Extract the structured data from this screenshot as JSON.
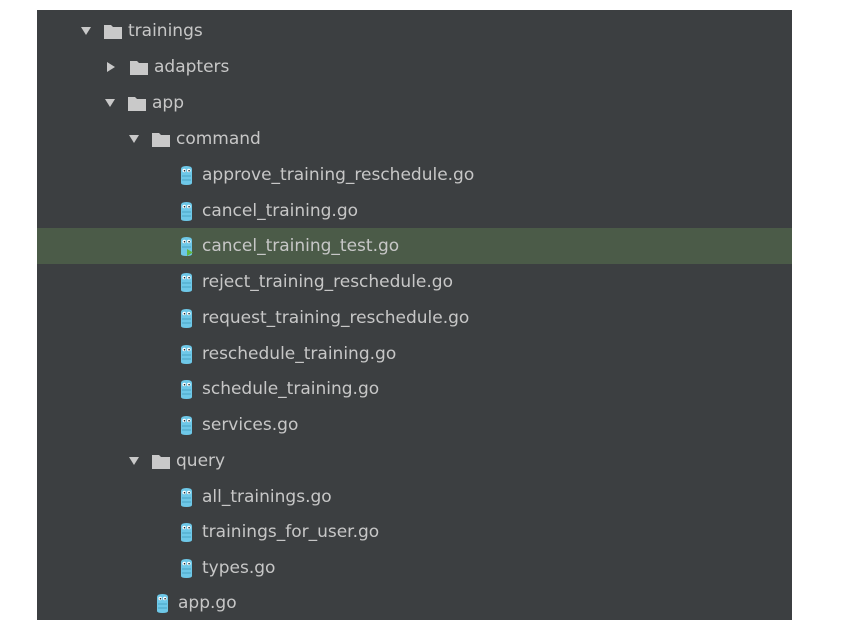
{
  "colors": {
    "panel_background": "#3c3f41",
    "selected_row": "#4b5b48",
    "text": "#c7c7c7",
    "folder": "#c9c9c9",
    "go_file_icon": "#6ec8e8"
  },
  "tree": {
    "trainings": {
      "label": "trainings",
      "state": "expanded",
      "icon": "folder-icon"
    },
    "adapters": {
      "label": "adapters",
      "state": "collapsed",
      "icon": "folder-icon"
    },
    "app": {
      "label": "app",
      "state": "expanded",
      "icon": "folder-icon"
    },
    "command": {
      "label": "command",
      "state": "expanded",
      "icon": "folder-icon"
    },
    "command_files": [
      {
        "label": "approve_training_reschedule.go",
        "icon": "go-file-icon"
      },
      {
        "label": "cancel_training.go",
        "icon": "go-file-icon"
      },
      {
        "label": "cancel_training_test.go",
        "icon": "go-test-file-icon",
        "selected": true
      },
      {
        "label": "reject_training_reschedule.go",
        "icon": "go-file-icon"
      },
      {
        "label": "request_training_reschedule.go",
        "icon": "go-file-icon"
      },
      {
        "label": "reschedule_training.go",
        "icon": "go-file-icon"
      },
      {
        "label": "schedule_training.go",
        "icon": "go-file-icon"
      },
      {
        "label": "services.go",
        "icon": "go-file-icon"
      }
    ],
    "query": {
      "label": "query",
      "state": "expanded",
      "icon": "folder-icon"
    },
    "query_files": [
      {
        "label": "all_trainings.go",
        "icon": "go-file-icon"
      },
      {
        "label": "trainings_for_user.go",
        "icon": "go-file-icon"
      },
      {
        "label": "types.go",
        "icon": "go-file-icon"
      }
    ],
    "app_files": [
      {
        "label": "app.go",
        "icon": "go-file-icon"
      }
    ]
  }
}
